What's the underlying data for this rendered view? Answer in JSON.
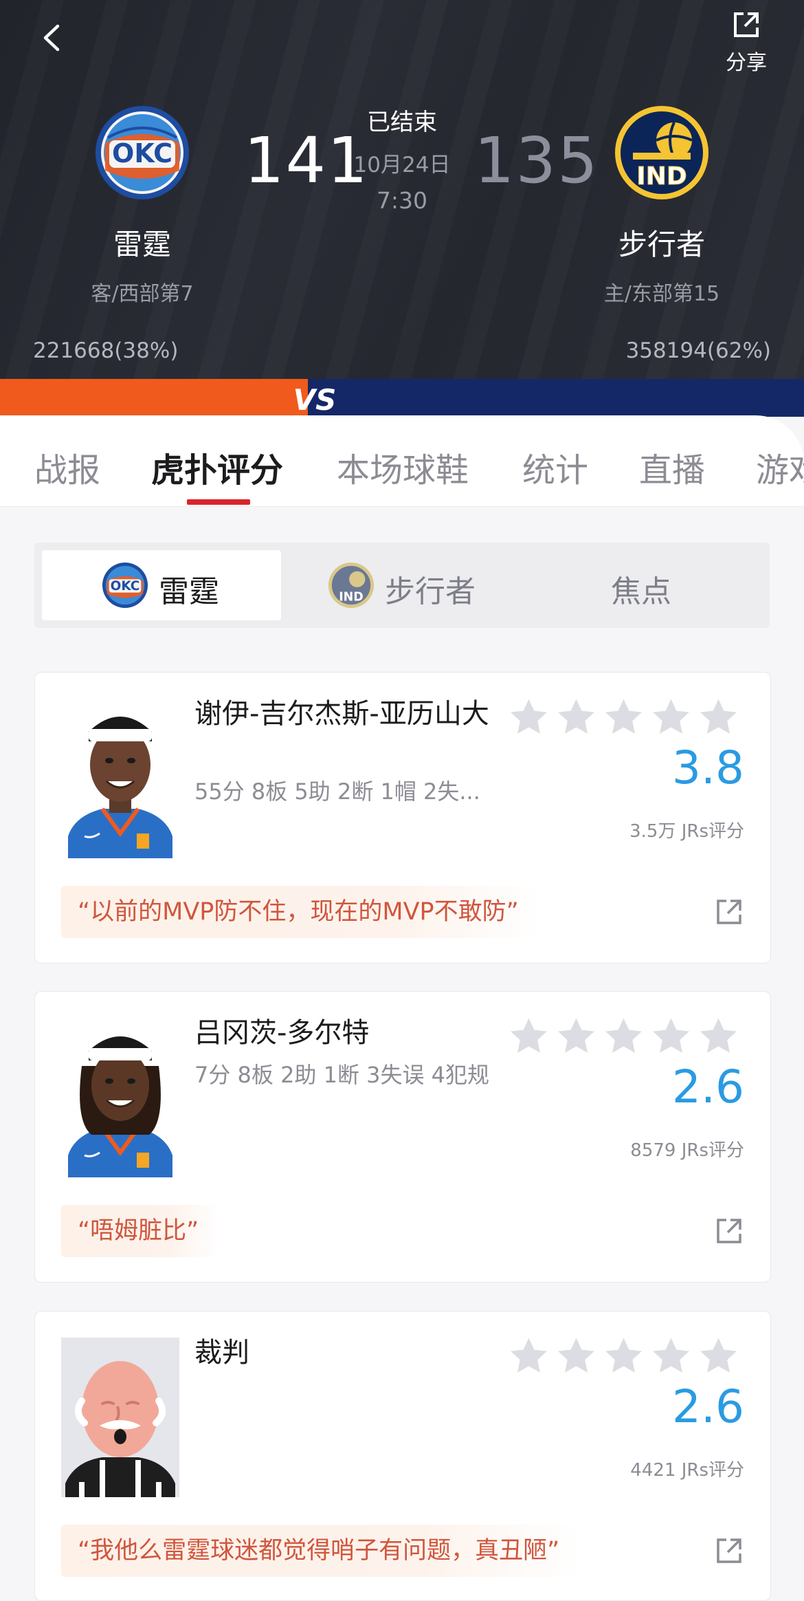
{
  "header": {
    "share_label": "分享",
    "status": "已结束",
    "date": "10月24日",
    "time": "7:30",
    "away": {
      "abbr": "OKC",
      "name": "雷霆",
      "rank": "客/西部第7",
      "score": "141",
      "support": "221668(38%)"
    },
    "home": {
      "abbr": "IND",
      "name": "步行者",
      "rank": "主/东部第15",
      "score": "135",
      "support": "358194(62%)"
    }
  },
  "vs_label": "VS",
  "tabs": [
    {
      "label": "战报"
    },
    {
      "label": "虎扑评分",
      "active": true
    },
    {
      "label": "本场球鞋"
    },
    {
      "label": "统计"
    },
    {
      "label": "直播"
    },
    {
      "label": "游戏"
    }
  ],
  "segment": {
    "items": [
      {
        "label": "雷霆",
        "active": true
      },
      {
        "label": "步行者"
      },
      {
        "label": "焦点"
      }
    ]
  },
  "players": [
    {
      "name": "谢伊-吉尔杰斯-亚历山大",
      "stats": "55分 8板 5助 2断 1帽 2失...",
      "rating": "3.8",
      "rating_count": "3.5万 JRs评分",
      "quote": "“以前的MVP防不住，现在的MVP不敢防”"
    },
    {
      "name": "吕冈茨-多尔特",
      "stats": "7分 8板 2助 1断 3失误 4犯规",
      "rating": "2.6",
      "rating_count": "8579 JRs评分",
      "quote": "“唔姆脏比”"
    },
    {
      "name": "裁判",
      "stats": "",
      "rating": "2.6",
      "rating_count": "4421 JRs评分",
      "quote": "“我他么雷霆球迷都觉得哨子有问题，真丑陋”"
    }
  ],
  "colors": {
    "header_bg": "#25272f",
    "okc_orange": "#f15a1d",
    "ind_navy": "#142767",
    "accent_red": "#d9252c",
    "rating_blue": "#2a9be2",
    "quote_text": "#d0563d"
  },
  "icons": {
    "back": "chevron-left-icon",
    "share": "share-external-icon",
    "star": "star-icon",
    "open": "open-external-icon"
  }
}
